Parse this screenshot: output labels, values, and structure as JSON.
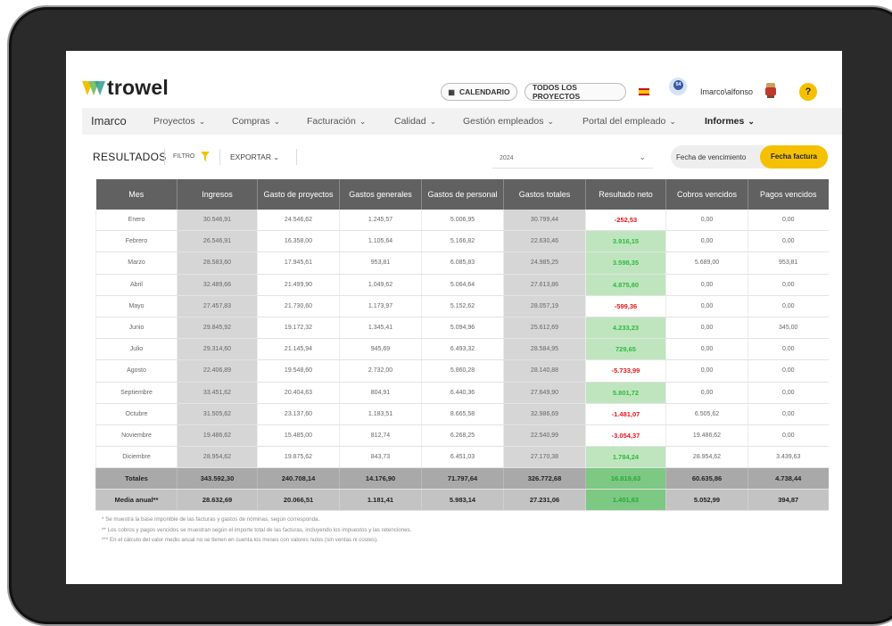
{
  "header": {
    "logo_text": "trowel",
    "calendar_label": "CALENDARIO",
    "all_projects_label": "TODOS LOS PROYECTOS",
    "avatar_badge": "54",
    "username": "Imarco\\alfonso",
    "help_label": "?"
  },
  "nav": {
    "company": "Imarco",
    "items": [
      {
        "label": "Proyectos"
      },
      {
        "label": "Compras"
      },
      {
        "label": "Facturación"
      },
      {
        "label": "Calidad"
      },
      {
        "label": "Gestión empleados"
      },
      {
        "label": "Portal del empleado"
      },
      {
        "label": "Informes"
      }
    ]
  },
  "toolbar": {
    "title": "RESULTADOS",
    "filter_label": "FILTRO",
    "export_label": "EXPORTAR",
    "year": "2024",
    "toggle_option_1": "Fecha de vencimiento",
    "toggle_option_2": "Fecha factura"
  },
  "table": {
    "columns": [
      "Mes",
      "Ingresos",
      "Gasto de proyectos",
      "Gastos generales",
      "Gastos de personal",
      "Gastos totales",
      "Resultado neto",
      "Cobros vencidos",
      "Pagos vencidos"
    ],
    "rows": [
      {
        "c": [
          "Enero",
          "30.546,91",
          "24.546,62",
          "1.245,57",
          "5.006,95",
          "30.799,44",
          "-252,53",
          "0,00",
          "0,00"
        ],
        "neg": true
      },
      {
        "c": [
          "Febrero",
          "26.546,91",
          "16.358,00",
          "1.105,64",
          "5.166,82",
          "22.630,46",
          "3.916,15",
          "0,00",
          "0,00"
        ],
        "neg": false
      },
      {
        "c": [
          "Marzo",
          "28.583,60",
          "17.945,61",
          "953,81",
          "6.085,83",
          "24.985,25",
          "3.598,35",
          "5.689,00",
          "953,81"
        ],
        "neg": false
      },
      {
        "c": [
          "Abril",
          "32.489,66",
          "21.499,90",
          "1.049,62",
          "5.064,64",
          "27.613,86",
          "4.875,80",
          "0,00",
          "0,00"
        ],
        "neg": false
      },
      {
        "c": [
          "Mayo",
          "27.457,83",
          "21.730,60",
          "1.173,97",
          "5.152,62",
          "28.057,19",
          "-599,36",
          "0,00",
          "0,00"
        ],
        "neg": true
      },
      {
        "c": [
          "Junio",
          "29.845,92",
          "19.172,32",
          "1.345,41",
          "5.094,96",
          "25.612,69",
          "4.233,23",
          "0,00",
          "345,00"
        ],
        "neg": false
      },
      {
        "c": [
          "Julio",
          "29.314,60",
          "21.145,94",
          "945,69",
          "6.493,32",
          "28.584,95",
          "729,65",
          "0,00",
          "0,00"
        ],
        "neg": false
      },
      {
        "c": [
          "Agosto",
          "22.406,89",
          "19.548,60",
          "2.732,00",
          "5.860,28",
          "28.140,88",
          "-5.733,99",
          "0,00",
          "0,00"
        ],
        "neg": true
      },
      {
        "c": [
          "Septiembre",
          "33.451,62",
          "20.404,63",
          "804,91",
          "6.440,36",
          "27.649,90",
          "5.801,72",
          "0,00",
          "0,00"
        ],
        "neg": false
      },
      {
        "c": [
          "Octubre",
          "31.505,62",
          "23.137,60",
          "1.183,51",
          "8.665,58",
          "32.986,69",
          "-1.481,07",
          "6.505,62",
          "0,00"
        ],
        "neg": true
      },
      {
        "c": [
          "Noviembre",
          "19.486,62",
          "15.485,00",
          "812,74",
          "6.268,25",
          "22.540,99",
          "-3.054,37",
          "19.486,62",
          "0,00"
        ],
        "neg": true
      },
      {
        "c": [
          "Diciembre",
          "28.954,62",
          "19.875,62",
          "843,73",
          "6.451,03",
          "27.170,38",
          "1.784,24",
          "28.954,62",
          "3.439,63"
        ],
        "neg": false
      }
    ],
    "totals": [
      "Totales",
      "343.592,30",
      "240.708,14",
      "14.176,90",
      "71.797,64",
      "326.772,68",
      "16.819,63",
      "60.635,86",
      "4.738,44"
    ],
    "media": [
      "Media anual**",
      "28.632,69",
      "20.066,51",
      "1.181,41",
      "5.983,14",
      "27.231,06",
      "1.401,63",
      "5.052,99",
      "394,87"
    ]
  },
  "notes": [
    "* Se muestra la base imponible de las facturas y gastos de nóminas, según corresponda.",
    "** Los cobros y pagos vencidos se muestran según el importe total de las facturas, incluyendo los impuestos y las retenciones.",
    "*** En el cálculo del valor medio anual no se tienen en cuenta los meses con valores nulos (sin ventas ni costes)."
  ],
  "colors": {
    "accent": "#f5c000",
    "header_bg": "#616161",
    "negative": "#e8161b",
    "positive": "#2fba3e"
  }
}
